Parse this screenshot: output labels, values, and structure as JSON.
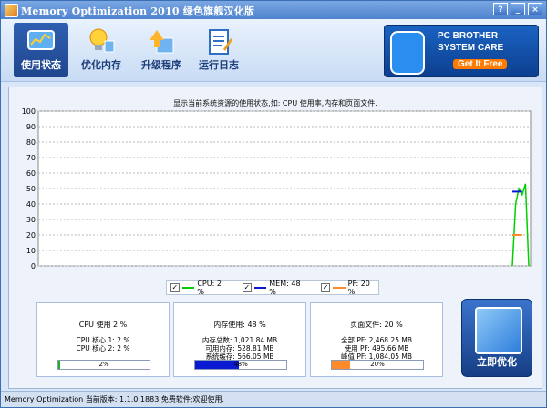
{
  "window": {
    "title": "Memory Optimization 2010 绿色旗舰汉化版"
  },
  "window_buttons": {
    "help": "?",
    "minimize": "_",
    "close": "×"
  },
  "toolbar": {
    "items": [
      {
        "label": "使用状态"
      },
      {
        "label": "优化内存"
      },
      {
        "label": "升级程序"
      },
      {
        "label": "运行日志"
      }
    ]
  },
  "ad": {
    "line1": "PC BROTHER",
    "line2": "SYSTEM CARE",
    "line3": "Get It Free"
  },
  "main": {
    "description": "显示当前系统资源的使用状态,如: CPU 使用率,内存和页面文件."
  },
  "chart_data": {
    "type": "line",
    "yticks": [
      0,
      10,
      20,
      30,
      40,
      50,
      60,
      70,
      80,
      90,
      100
    ],
    "ylim": [
      0,
      100
    ],
    "series": [
      {
        "name": "CPU: 2 %",
        "color": "#00d000",
        "values": [
          0,
          40,
          50,
          46,
          53,
          0
        ]
      },
      {
        "name": "MEM: 48 %",
        "color": "#0a1ad0",
        "values": [
          48,
          48,
          48,
          48
        ]
      },
      {
        "name": "PF: 20 %",
        "color": "#ff8a2a",
        "values": [
          20,
          20,
          20,
          20
        ]
      }
    ]
  },
  "legend": {
    "items": [
      "CPU: 2 %",
      "MEM: 48 %",
      "PF: 20 %"
    ]
  },
  "panels": {
    "cpu": {
      "title": "CPU 使用 2 %",
      "lines": [
        "CPU 核心 1: 2 %",
        "CPU 核心 2: 2 %"
      ],
      "bar_text": "2%",
      "bar_value": 0.02,
      "bar_color": "#1fb31f"
    },
    "mem": {
      "title": "内存使用: 48 %",
      "lines": [
        "内存总数: 1,021.84 MB",
        "可用内存: 528.81 MB",
        "系统缓存: 566.05 MB"
      ],
      "bar_text": "48%",
      "bar_value": 0.48,
      "bar_color": "#0a1ad0"
    },
    "pf": {
      "title": "页面文件: 20 %",
      "lines": [
        "全部 PF: 2,468.25 MB",
        "使用 PF: 495.66 MB",
        "峰值 PF: 1,084.05 MB"
      ],
      "bar_text": "20%",
      "bar_value": 0.2,
      "bar_color": "#ff8a2a"
    }
  },
  "optimize_button": {
    "label": "立即优化"
  },
  "status": {
    "text": "Memory Optimization 当前版本: 1.1.0.1883 免费软件;欢迎使用."
  }
}
